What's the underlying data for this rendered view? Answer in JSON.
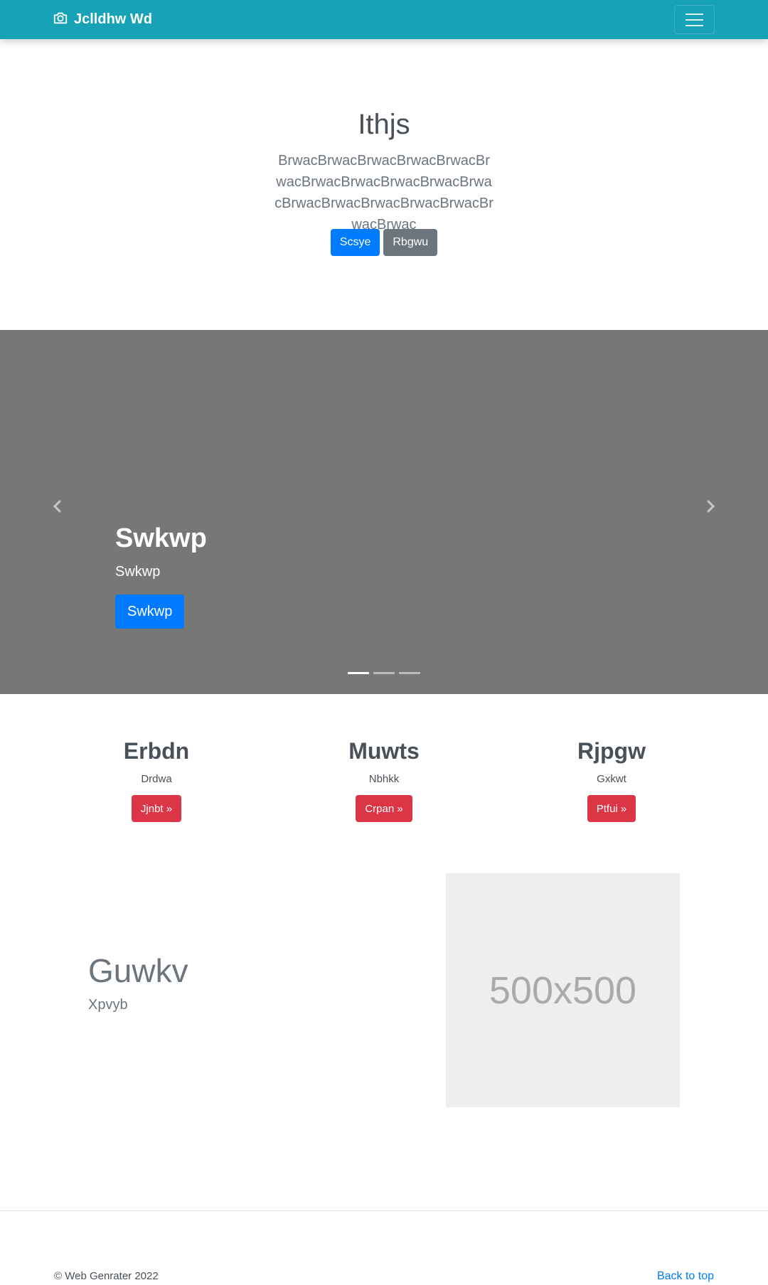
{
  "navbar": {
    "brand": "Jclldhw Wd",
    "brand_icon": "camera-icon",
    "menu_icon": "hamburger-menu-icon",
    "background": "#17a2b8"
  },
  "jumbotron": {
    "title": "Ithjs",
    "lead": "BrwacBrwacBrwacBrwacBrwacBrwacBrwacBrwacBrwacBrwacBrwacBrwacBrwacBrwacBrwacBrwacBrwacBrwac",
    "primary_button": "Scsye",
    "secondary_button": "Rbgwu"
  },
  "carousel": {
    "heading": "Swkwp",
    "text": "Swkwp",
    "button": "Swkwp",
    "background": "#777777",
    "active_slide": 1,
    "slide_count": 3
  },
  "columns": [
    {
      "title": "Erbdn",
      "text": "Drdwa",
      "button": "Jjnbt »"
    },
    {
      "title": "Muwts",
      "text": "Nbhkk",
      "button": "Crpan »"
    },
    {
      "title": "Rjpgw",
      "text": "Gxkwt",
      "button": "Ptfui »"
    }
  ],
  "feature": {
    "heading": "Guwkv",
    "subtext": "Xpvyb",
    "image_placeholder": "500x500"
  },
  "footer": {
    "copyright": "© Web Genrater 2022",
    "back_to_top": "Back to top"
  },
  "colors": {
    "primary": "#007bff",
    "secondary": "#6c757d",
    "danger": "#dc3545"
  }
}
